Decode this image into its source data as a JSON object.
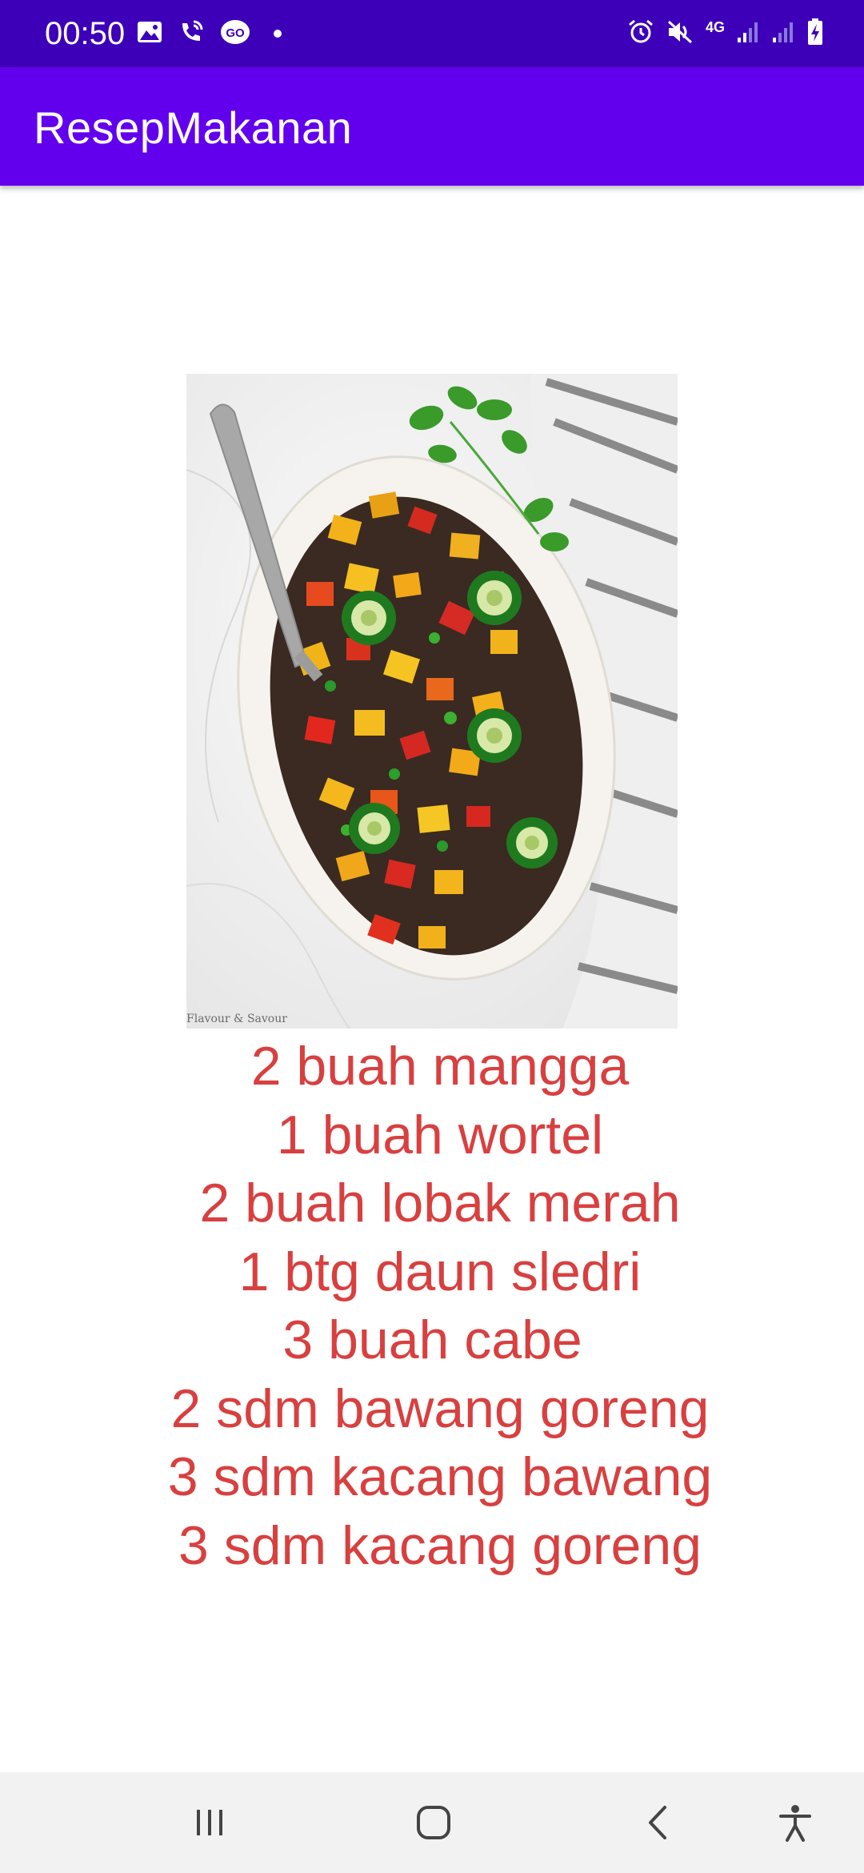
{
  "status_bar": {
    "time": "00:50",
    "network_label": "4G",
    "icons": [
      "gallery-icon",
      "wifi-call-icon",
      "go-icon",
      "dot-icon",
      "alarm-icon",
      "mute-icon",
      "signal-icon",
      "signal-icon",
      "battery-charging-icon"
    ]
  },
  "app_bar": {
    "title": "ResepMakanan"
  },
  "image": {
    "watermark": "Flavour & Savour"
  },
  "ingredients": [
    "2 buah mangga",
    "1 buah wortel",
    "2 buah lobak merah",
    "1 btg daun sledri",
    "3 buah cabe ",
    "2 sdm bawang goreng",
    "3 sdm kacang bawang",
    "3 sdm kacang goreng"
  ],
  "nav_bar": {
    "buttons": [
      "recents-button",
      "home-button",
      "back-button",
      "accessibility-button"
    ]
  },
  "colors": {
    "status_bar": "#3d00b8",
    "app_bar": "#6200ee",
    "ingredient_text": "#d84040",
    "nav_bar": "#f2f2f2"
  }
}
